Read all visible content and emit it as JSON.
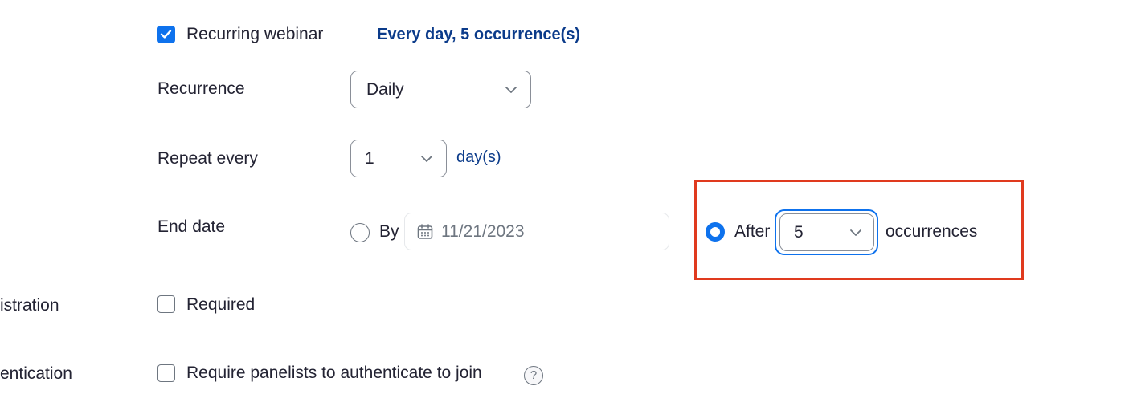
{
  "recurring": {
    "checkbox_label": "Recurring webinar",
    "summary": "Every day, 5 occurrence(s)"
  },
  "recurrence": {
    "label": "Recurrence",
    "selected": "Daily"
  },
  "repeat_every": {
    "label": "Repeat every",
    "selected": "1",
    "unit": "day(s)"
  },
  "end_date": {
    "label": "End date",
    "by_label": "By",
    "by_date": "11/21/2023",
    "after_label": "After",
    "after_selected": "5",
    "occurrences_label": "occurrences"
  },
  "registration": {
    "label": "istration",
    "checkbox_label": "Required"
  },
  "authentication": {
    "label": "entication",
    "checkbox_label": "Require panelists to authenticate to join",
    "help_glyph": "?"
  },
  "colors": {
    "accent": "#0e72ed",
    "link_text": "#0b3b8a",
    "highlight_border": "#e03a1e"
  },
  "icons": [
    "checkmark-icon",
    "chevron-down-icon",
    "calendar-icon",
    "help-icon"
  ]
}
